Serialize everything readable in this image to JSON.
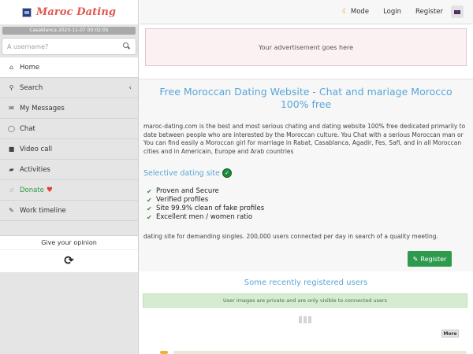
{
  "brand": {
    "name": "Maroc Dating"
  },
  "datetime": "Casablanca 2023-11-07 00:02:05",
  "search": {
    "placeholder": "A username?"
  },
  "menu": {
    "items": [
      {
        "label": "Home",
        "icon": "home-icon"
      },
      {
        "label": "Search",
        "icon": "search-icon"
      },
      {
        "label": "My Messages",
        "icon": "envelope-icon"
      },
      {
        "label": "Chat",
        "icon": "chat-icon"
      },
      {
        "label": "Video call",
        "icon": "video-camera-icon"
      },
      {
        "label": "Activities",
        "icon": "folder-icon"
      },
      {
        "label": "Donate",
        "icon": "thumbs-up-icon"
      },
      {
        "label": "Work timeline",
        "icon": "wrench-icon"
      }
    ]
  },
  "opinion": {
    "title": "Give your opinion"
  },
  "topnav": {
    "mode": "Mode",
    "login": "Login",
    "register": "Register"
  },
  "ad": {
    "text": "Your advertisement goes here"
  },
  "welcome": {
    "title": "Free Moroccan Dating Website - Chat and mariage Morocco 100% free",
    "intro": "maroc-dating.com is the best and most serious chating and dating website 100% free dedicated primarily to date between people who are interested by the Moroccan culture. You Chat with a serious Moroccan man or You can find easily a Moroccan girl for marriage in Rabat, Casablanca, Agadir, Fes, Safi, and in all Moroccan cities and in Americain, Europe and Arab countries",
    "selective": "Selective dating site",
    "features": [
      "Proven and Secure",
      "Verified profiles",
      "Site 99.9% clean of fake profiles",
      "Excellent men / women ratio"
    ],
    "footnote": "dating site for demanding singles. 200,000 users connected per day in search of a quality meeting.",
    "register_label": "Register"
  },
  "recent": {
    "title": "Some recently registered users",
    "info": "User images are private and are only visible to connected users",
    "more_label": "More"
  },
  "colors": {
    "accent_blue": "#5aa6d8",
    "brand_red": "#e2564f",
    "register_green": "#2e9a4e"
  }
}
